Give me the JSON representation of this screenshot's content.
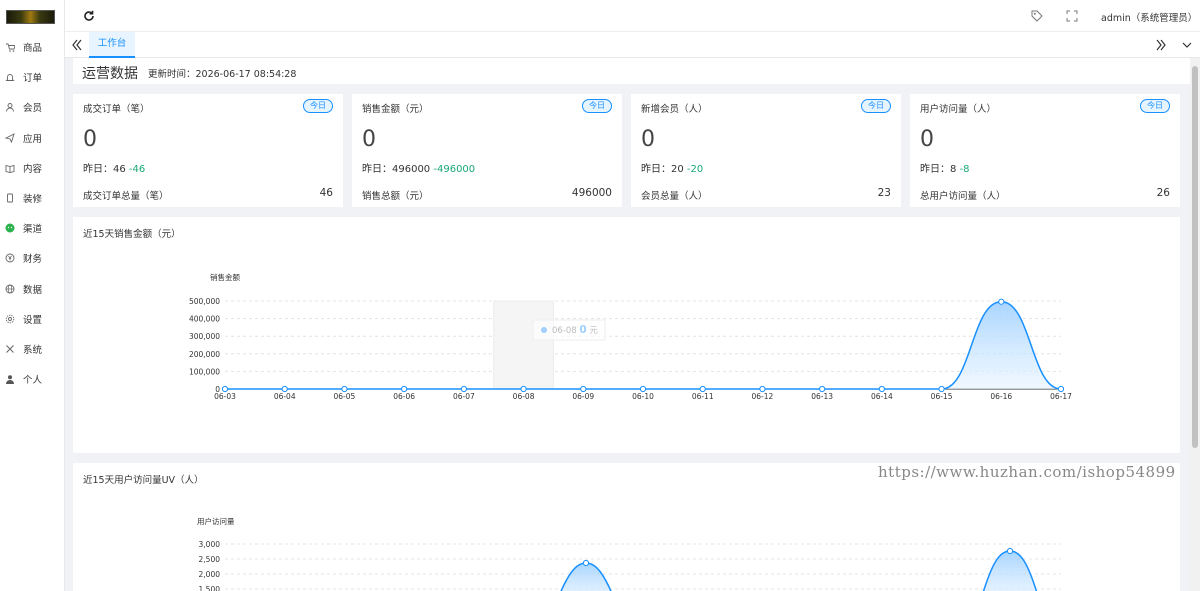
{
  "sidebar": {
    "items": [
      {
        "label": "商品",
        "icon": "cart-icon"
      },
      {
        "label": "订单",
        "icon": "bell-icon"
      },
      {
        "label": "会员",
        "icon": "user-icon"
      },
      {
        "label": "应用",
        "icon": "send-icon"
      },
      {
        "label": "内容",
        "icon": "book-icon"
      },
      {
        "label": "装修",
        "icon": "phone-icon"
      },
      {
        "label": "渠道",
        "icon": "wechat-icon"
      },
      {
        "label": "财务",
        "icon": "yen-icon"
      },
      {
        "label": "数据",
        "icon": "globe-icon"
      },
      {
        "label": "设置",
        "icon": "gear-icon"
      },
      {
        "label": "系统",
        "icon": "tools-icon"
      },
      {
        "label": "个人",
        "icon": "person-icon"
      }
    ]
  },
  "header": {
    "user": "admin（系统管理员）"
  },
  "tabs": {
    "active": "工作台"
  },
  "overview": {
    "title": "运营数据",
    "updated": "更新时间：2026-06-17 08:54:28"
  },
  "cards": [
    {
      "name": "成交订单（笔）",
      "badge": "今日",
      "value": "0",
      "yesterday_label": "昨日：46",
      "diff": "-46",
      "total_label": "成交订单总量（笔）",
      "total": "46"
    },
    {
      "name": "销售金额（元）",
      "badge": "今日",
      "value": "0",
      "yesterday_label": "昨日：496000",
      "diff": "-496000",
      "total_label": "销售总额（元）",
      "total": "496000"
    },
    {
      "name": "新增会员（人）",
      "badge": "今日",
      "value": "0",
      "yesterday_label": "昨日：20",
      "diff": "-20",
      "total_label": "会员总量（人）",
      "total": "23"
    },
    {
      "name": "用户访问量（人）",
      "badge": "今日",
      "value": "0",
      "yesterday_label": "昨日：8",
      "diff": "-8",
      "total_label": "总用户访问量（人）",
      "total": "26"
    }
  ],
  "chart_data": [
    {
      "type": "area",
      "title": "近15天销售金额（元）",
      "ylabel": "销售金额",
      "categories": [
        "06-03",
        "06-04",
        "06-05",
        "06-06",
        "06-07",
        "06-08",
        "06-09",
        "06-10",
        "06-11",
        "06-12",
        "06-13",
        "06-14",
        "06-15",
        "06-16",
        "06-17"
      ],
      "values": [
        0,
        0,
        0,
        0,
        0,
        0,
        0,
        0,
        0,
        0,
        0,
        0,
        0,
        496000,
        0
      ],
      "yticks": [
        "0",
        "100,000",
        "200,000",
        "300,000",
        "400,000",
        "500,000"
      ],
      "ylim": [
        0,
        500000
      ],
      "grid": true,
      "tooltip": {
        "date": "06-08",
        "value": "0",
        "unit": "元"
      },
      "color": "#1890ff"
    },
    {
      "type": "area",
      "title": "近15天用户访问量UV（人）",
      "ylabel": "用户访问量",
      "yticks": [
        "1,500",
        "2,000",
        "2,500",
        "3,000"
      ],
      "ylim": [
        1500,
        3000
      ],
      "grid": true,
      "color": "#1890ff"
    }
  ],
  "watermark": "https://www.huzhan.com/ishop54899"
}
